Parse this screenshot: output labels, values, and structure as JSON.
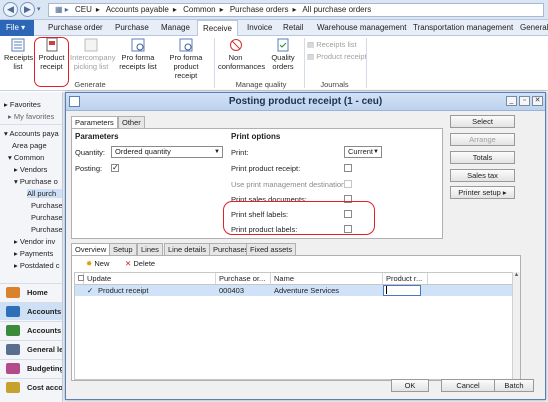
{
  "addressbar": {
    "breadcrumb": [
      "CEU",
      "Accounts payable",
      "Common",
      "Purchase orders",
      "All purchase orders"
    ]
  },
  "tabs": {
    "file": "File",
    "items": [
      "Purchase order",
      "Purchase",
      "Manage",
      "Receive",
      "Invoice",
      "Retail",
      "Warehouse management",
      "Transportation management",
      "General"
    ],
    "active": "Receive"
  },
  "ribbon": {
    "buttons": {
      "receipts_list": "Receipts list",
      "product_receipt": "Product receipt",
      "intercompany": "Intercompany picking list",
      "pro_forma_receipts": "Pro forma receipts list",
      "pro_forma_product": "Pro forma product receipt",
      "non_conformances": "Non conformances",
      "quality_orders": "Quality orders",
      "journals_receipts": "Receipts list",
      "journals_product": "Product receipt"
    },
    "groups": {
      "generate": "Generate",
      "manage_quality": "Manage quality",
      "journals": "Journals"
    }
  },
  "leftnav": {
    "favorites": "Favorites",
    "my_favorites": "My favorites",
    "accounts_payable": "Accounts paya",
    "area_page": "Area page",
    "common": "Common",
    "vendors": "Vendors",
    "purchase_orders": "Purchase o",
    "all_purchase": "All purch",
    "purchase1": "Purchase",
    "purchase2": "Purchase",
    "purchase3": "Purchase",
    "vendor_invoices": "Vendor inv",
    "payments": "Payments",
    "postdated": "Postdated c",
    "modules": [
      "Home",
      "Accounts p",
      "Accounts re",
      "General le",
      "Budgeting",
      "Cost accou"
    ]
  },
  "dialog": {
    "title": "Posting product receipt (1 - ceu)",
    "tabs": [
      "Parameters",
      "Other"
    ],
    "parameters": {
      "header": "Parameters",
      "quantity_label": "Quantity:",
      "quantity_value": "Ordered quantity",
      "posting_label": "Posting:",
      "posting_checked": true
    },
    "print_options": {
      "header": "Print options",
      "print_label": "Print:",
      "print_value": "Current",
      "print_product_receipt": "Print product receipt:",
      "use_print_mgmt": "Use print management destination:",
      "print_sales_documents": "Print sales documents:",
      "print_shelf_labels": "Print shelf labels:",
      "print_product_labels": "Print product labels:"
    },
    "side_buttons": {
      "select": "Select",
      "arrange": "Arrange",
      "totals": "Totals",
      "sales_tax": "Sales tax",
      "printer_setup": "Printer setup"
    },
    "lower_tabs": [
      "Overview",
      "Setup",
      "Lines",
      "Line details",
      "Purchases",
      "Fixed assets"
    ],
    "grid_toolbar": {
      "new": "New",
      "delete": "Delete"
    },
    "grid": {
      "columns": [
        "Update",
        "Purchase or...",
        "Name",
        "Product r..."
      ],
      "rows": [
        {
          "checked": true,
          "update": "Product receipt",
          "purchase_order": "000403",
          "name": "Adventure Services",
          "product_receipt": ""
        }
      ]
    },
    "bottom_buttons": {
      "ok": "OK",
      "cancel": "Cancel",
      "batch": "Batch"
    }
  }
}
